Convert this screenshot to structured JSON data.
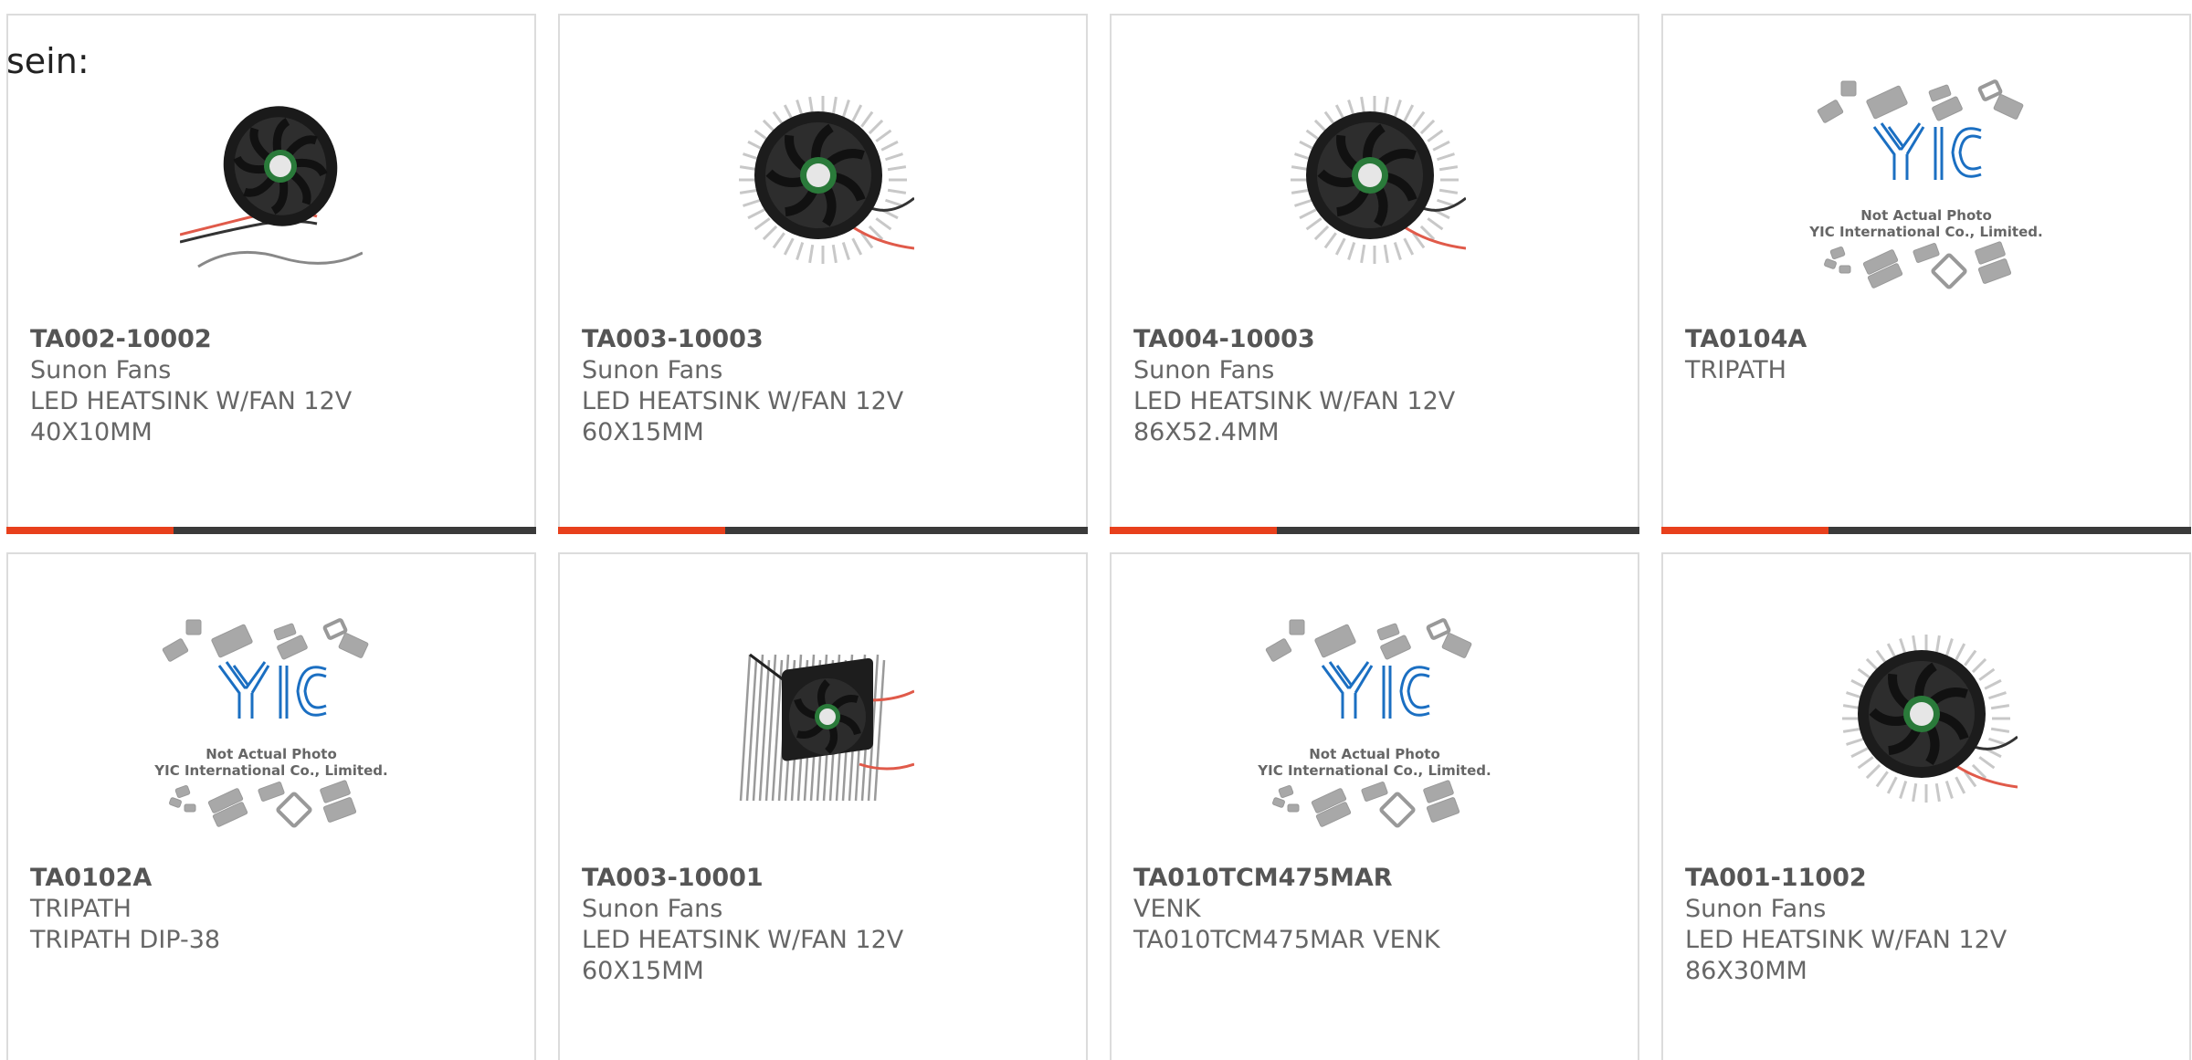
{
  "lead_text": "sein:",
  "colors": {
    "accent": "#e8401c",
    "bar": "#3a3a3a",
    "border": "#dcdcdc",
    "yic_blue": "#1b6fc2"
  },
  "placeholder": {
    "line1": "Not Actual Photo",
    "line2": "YIC International Co., Limited.",
    "logo_text": "YIC"
  },
  "products": [
    {
      "part": "TA002-10002",
      "maker": "Sunon Fans",
      "desc1": "LED HEATSINK W/FAN 12V",
      "desc2": "40X10MM",
      "image": "fan-small-icon"
    },
    {
      "part": "TA003-10003",
      "maker": "Sunon Fans",
      "desc1": "LED HEATSINK W/FAN 12V",
      "desc2": "60X15MM",
      "image": "fan-heatsink-icon"
    },
    {
      "part": "TA004-10003",
      "maker": "Sunon Fans",
      "desc1": "LED HEATSINK W/FAN 12V",
      "desc2": "86X52.4MM",
      "image": "fan-heatsink-icon"
    },
    {
      "part": "TA0104A",
      "maker": "TRIPATH",
      "desc1": "",
      "desc2": "",
      "image": "yic-placeholder"
    },
    {
      "part": "TA0102A",
      "maker": "TRIPATH",
      "desc1": "TRIPATH DIP-38",
      "desc2": "",
      "image": "yic-placeholder"
    },
    {
      "part": "TA003-10001",
      "maker": "Sunon Fans",
      "desc1": "LED HEATSINK W/FAN 12V",
      "desc2": "60X15MM",
      "image": "square-heatsink-icon"
    },
    {
      "part": "TA010TCM475MAR",
      "maker": "VENK",
      "desc1": "TA010TCM475MAR VENK",
      "desc2": "",
      "image": "yic-placeholder"
    },
    {
      "part": "TA001-11002",
      "maker": "Sunon Fans",
      "desc1": "LED HEATSINK W/FAN 12V",
      "desc2": "86X30MM",
      "image": "fan-heatsink-icon"
    }
  ]
}
